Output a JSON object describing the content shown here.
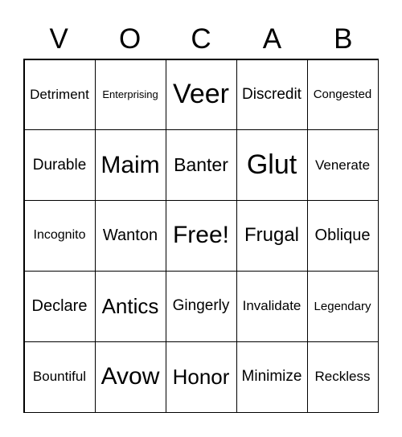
{
  "header": [
    "V",
    "O",
    "C",
    "A",
    "B"
  ],
  "cells": [
    [
      "Detriment",
      "Enterprising",
      "Veer",
      "Discredit",
      "Congested"
    ],
    [
      "Durable",
      "Maim",
      "Banter",
      "Glut",
      "Venerate"
    ],
    [
      "Incognito",
      "Wanton",
      "Free!",
      "Frugal",
      "Oblique"
    ],
    [
      "Declare",
      "Antics",
      "Gingerly",
      "Invalidate",
      "Legendary"
    ],
    [
      "Bountiful",
      "Avow",
      "Honor",
      "Minimize",
      "Reckless"
    ]
  ]
}
